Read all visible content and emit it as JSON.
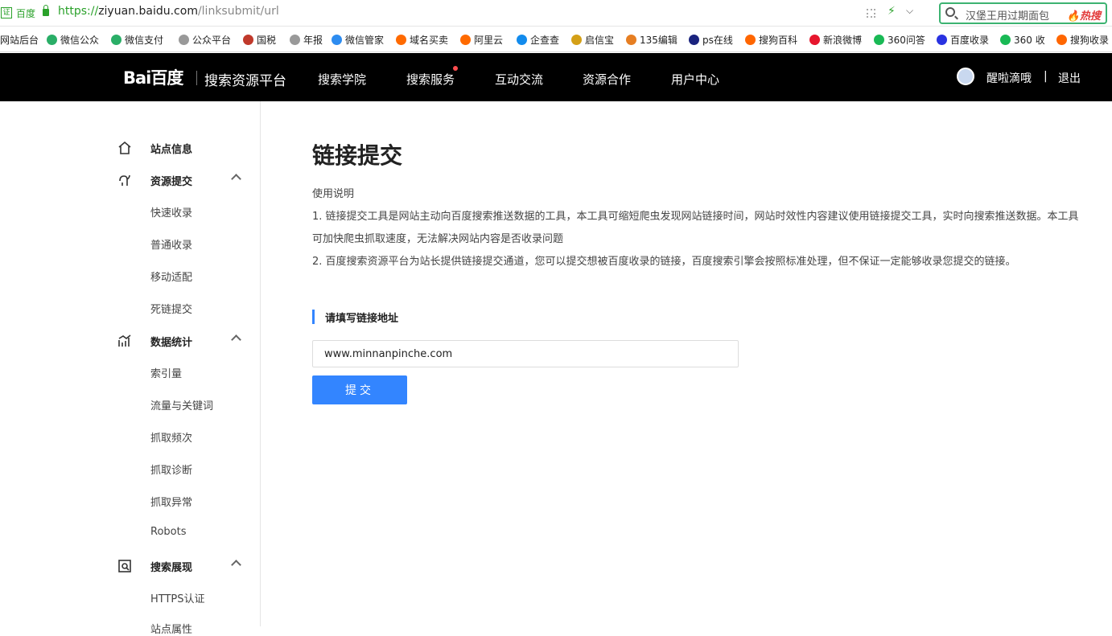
{
  "browser": {
    "cert_label": "证",
    "site_name": "百度",
    "url_scheme": "https://",
    "url_host": "ziyuan.baidu.com",
    "url_path": "/linksubmit/url",
    "search_query": "汉堡王用过期面包",
    "hot_label": "热搜",
    "bookmarks": [
      {
        "label": "网站后台",
        "color": ""
      },
      {
        "label": "微信公众",
        "color": "#2aae67"
      },
      {
        "label": "微信支付",
        "color": "#2aae67"
      },
      {
        "label": "公众平台",
        "color": "#999999"
      },
      {
        "label": "国税",
        "color": "#c0392b"
      },
      {
        "label": "年报",
        "color": "#999999"
      },
      {
        "label": "微信管家",
        "color": "#2d8cf0"
      },
      {
        "label": "域名买卖",
        "color": "#ff6a00"
      },
      {
        "label": "阿里云",
        "color": "#ff6a00"
      },
      {
        "label": "企查查",
        "color": "#128bed"
      },
      {
        "label": "启信宝",
        "color": "#d4a017"
      },
      {
        "label": "135编辑",
        "color": "#e67e22"
      },
      {
        "label": "ps在线",
        "color": "#1a237e"
      },
      {
        "label": "搜狗百科",
        "color": "#ff6600"
      },
      {
        "label": "新浪微博",
        "color": "#e6162d"
      },
      {
        "label": "360问答",
        "color": "#19b955"
      },
      {
        "label": "百度收录",
        "color": "#2932e1"
      },
      {
        "label": "360 收",
        "color": "#19b955"
      },
      {
        "label": "搜狗收录",
        "color": "#ff6600"
      }
    ]
  },
  "header": {
    "logo_text": "Bai百度",
    "platform_name": "搜索资源平台",
    "nav": [
      "搜索学院",
      "搜索服务",
      "互动交流",
      "资源合作",
      "用户中心"
    ],
    "user_name": "醒啦滴哦",
    "separator": "|",
    "logout_label": "退出"
  },
  "sidebar": {
    "groups": [
      {
        "label": "站点信息",
        "icon": "home-icon",
        "items": []
      },
      {
        "label": "资源提交",
        "icon": "submit-icon",
        "items": [
          "快速收录",
          "普通收录",
          "移动适配",
          "死链提交"
        ]
      },
      {
        "label": "数据统计",
        "icon": "chart-icon",
        "items": [
          "索引量",
          "流量与关键词",
          "抓取频次",
          "抓取诊断",
          "抓取异常",
          "Robots"
        ]
      },
      {
        "label": "搜索展现",
        "icon": "search-display-icon",
        "items": [
          "HTTPS认证",
          "站点属性"
        ]
      }
    ]
  },
  "main": {
    "title": "链接提交",
    "desc_heading": "使用说明",
    "desc_line1": "1. 链接提交工具是网站主动向百度搜索推送数据的工具，本工具可缩短爬虫发现网站链接时间，网站时效性内容建议使用链接提交工具，实时向搜索推送数据。本工具可加快爬虫抓取速度，无法解决网站内容是否收录问题",
    "desc_line2": "2. 百度搜索资源平台为站长提供链接提交通道，您可以提交想被百度收录的链接，百度搜索引擎会按照标准处理，但不保证一定能够收录您提交的链接。",
    "section_title": "请填写链接地址",
    "url_value": "www.minnanpinche.com",
    "submit_label": "提交"
  }
}
